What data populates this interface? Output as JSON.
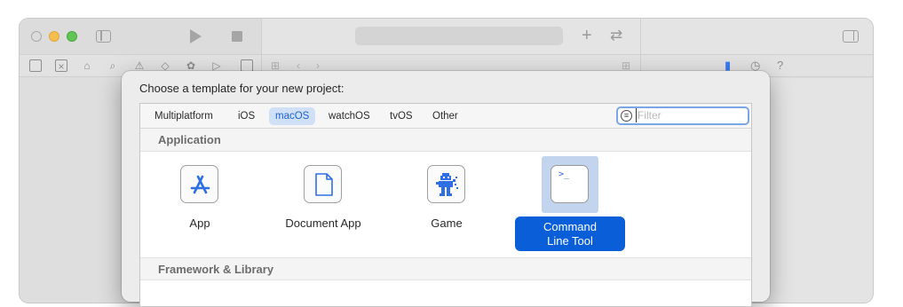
{
  "window": {
    "traffic_lights": [
      "close",
      "minimize",
      "zoom"
    ],
    "toolbar_icons": [
      "sidebar-toggle-icon",
      "play-icon",
      "stop-icon",
      "plus-icon",
      "swap-icon",
      "inspector-toggle-icon"
    ]
  },
  "sheet": {
    "title": "Choose a template for your new project:",
    "tabs": [
      {
        "label": "Multiplatform",
        "active": false
      },
      {
        "label": "iOS",
        "active": false
      },
      {
        "label": "macOS",
        "active": true
      },
      {
        "label": "watchOS",
        "active": false
      },
      {
        "label": "tvOS",
        "active": false
      },
      {
        "label": "Other",
        "active": false
      }
    ],
    "filter": {
      "placeholder": "Filter",
      "value": ""
    },
    "sections": [
      {
        "title": "Application",
        "templates": [
          {
            "label": "App",
            "icon": "app-store-icon",
            "selected": false
          },
          {
            "label": "Document App",
            "icon": "document-icon",
            "selected": false
          },
          {
            "label": "Game",
            "icon": "game-sprite-icon",
            "selected": false
          },
          {
            "label": "Command\nLine Tool",
            "icon": "terminal-icon",
            "selected": true
          }
        ]
      },
      {
        "title": "Framework & Library",
        "templates": []
      }
    ]
  },
  "colors": {
    "accent": "#0a5fd8",
    "selection_bg": "#c3d5ee",
    "active_tab_bg": "#cfe0f7"
  }
}
